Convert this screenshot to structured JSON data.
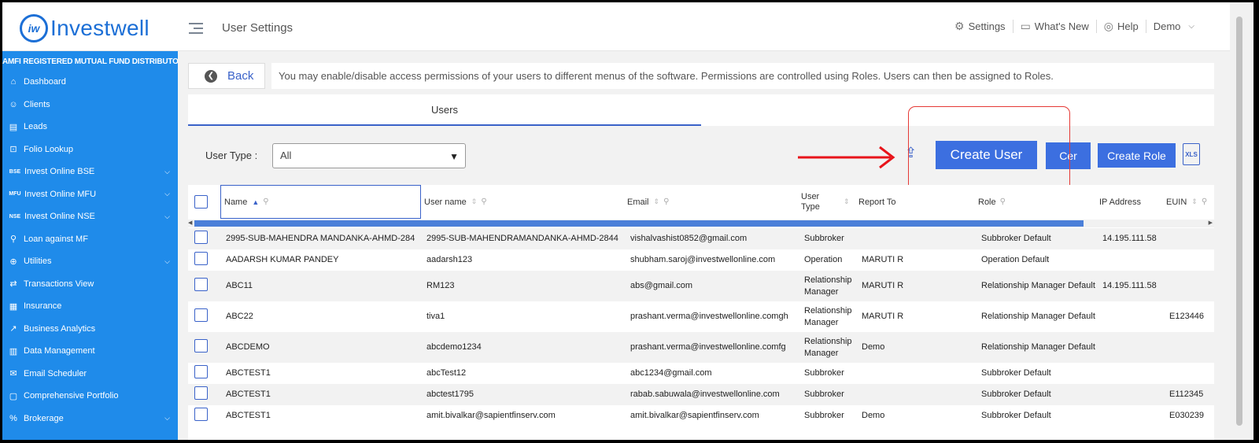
{
  "logo": {
    "mark": "iw",
    "text": "Investwell"
  },
  "header": {
    "page_title": "User Settings",
    "nav": [
      {
        "icon": "gear-icon",
        "glyph": "⚙",
        "label": "Settings"
      },
      {
        "icon": "chat-icon",
        "glyph": "▭",
        "label": "What's New"
      },
      {
        "icon": "help-icon",
        "glyph": "◎",
        "label": "Help"
      },
      {
        "icon": "",
        "glyph": "",
        "label": "Demo"
      }
    ]
  },
  "sidebar": {
    "banner": "AMFI REGISTERED MUTUAL FUND DISTRIBUTOR",
    "items": [
      {
        "icon": "home-icon",
        "glyph": "⌂",
        "label": "Dashboard",
        "chevron": false
      },
      {
        "icon": "users-icon",
        "glyph": "☺",
        "label": "Clients",
        "chevron": false
      },
      {
        "icon": "leads-icon",
        "glyph": "▤",
        "label": "Leads",
        "chevron": false
      },
      {
        "icon": "folio-icon",
        "glyph": "⊡",
        "label": "Folio Lookup",
        "chevron": false
      },
      {
        "icon": "bse-icon",
        "glyph": "BSE",
        "label": "Invest Online BSE",
        "chevron": true
      },
      {
        "icon": "mfu-icon",
        "glyph": "MFU",
        "label": "Invest Online MFU",
        "chevron": true
      },
      {
        "icon": "nse-icon",
        "glyph": "NSE",
        "label": "Invest Online NSE",
        "chevron": true
      },
      {
        "icon": "loan-icon",
        "glyph": "⚲",
        "label": "Loan against MF",
        "chevron": false
      },
      {
        "icon": "utilities-icon",
        "glyph": "⊕",
        "label": "Utilities",
        "chevron": true
      },
      {
        "icon": "transactions-icon",
        "glyph": "⇄",
        "label": "Transactions View",
        "chevron": false
      },
      {
        "icon": "insurance-icon",
        "glyph": "▦",
        "label": "Insurance",
        "chevron": false
      },
      {
        "icon": "analytics-icon",
        "glyph": "↗",
        "label": "Business Analytics",
        "chevron": false
      },
      {
        "icon": "data-icon",
        "glyph": "▥",
        "label": "Data Management",
        "chevron": false
      },
      {
        "icon": "email-icon",
        "glyph": "✉",
        "label": "Email Scheduler",
        "chevron": false
      },
      {
        "icon": "portfolio-icon",
        "glyph": "▢",
        "label": "Comprehensive Portfolio",
        "chevron": false
      },
      {
        "icon": "brokerage-icon",
        "glyph": "%",
        "label": "Brokerage",
        "chevron": true
      }
    ]
  },
  "content": {
    "back_label": "Back",
    "info_text": "You may enable/disable access permissions of your users to different menus of the software. Permissions are controlled using Roles. Users can then be assigned to Roles.",
    "tabs": [
      "Users",
      ""
    ],
    "user_type_label": "User Type :",
    "user_type_value": "All",
    "create_user_label": "Create User",
    "cer_label": "Cer",
    "create_role_label": "Create Role",
    "xls_label": "XLS"
  },
  "table": {
    "columns": [
      "Name",
      "User name",
      "Email",
      "User Type",
      "Report To",
      "Role",
      "IP Address",
      "EUIN"
    ],
    "rows": [
      [
        "2995-SUB-MAHENDRA MANDANKA-AHMD-284",
        "2995-SUB-MAHENDRAMANDANKA-AHMD-2844",
        "vishalvashist0852@gmail.com",
        "Subbroker",
        "",
        "Subbroker Default",
        "14.195.111.58",
        ""
      ],
      [
        "AADARSH KUMAR PANDEY",
        "aadarsh123",
        "shubham.saroj@investwellonline.com",
        "Operation",
        "MARUTI R",
        "Operation Default",
        "",
        ""
      ],
      [
        "ABC11",
        "RM123",
        "abs@gmail.com",
        "Relationship Manager",
        "MARUTI R",
        "Relationship Manager Default",
        "14.195.111.58",
        ""
      ],
      [
        "ABC22",
        "tiva1",
        "prashant.verma@investwellonline.comgh",
        "Relationship Manager",
        "MARUTI R",
        "Relationship Manager Default",
        "",
        "E123446"
      ],
      [
        "ABCDEMO",
        "abcdemo1234",
        "prashant.verma@investwellonline.comfg",
        "Relationship Manager",
        "Demo",
        "Relationship Manager Default",
        "",
        ""
      ],
      [
        "ABCTEST1",
        "abcTest12",
        "abc1234@gmail.com",
        "Subbroker",
        "",
        "Subbroker Default",
        "",
        ""
      ],
      [
        "ABCTEST1",
        "abctest1795",
        "rabab.sabuwala@investwellonline.com",
        "Subbroker",
        "",
        "Subbroker Default",
        "",
        "E112345"
      ],
      [
        "ABCTEST1",
        "amit.bivalkar@sapientfinserv.com",
        "amit.bivalkar@sapientfinserv.com",
        "Subbroker",
        "Demo",
        "Subbroker Default",
        "",
        "E030239"
      ]
    ]
  }
}
